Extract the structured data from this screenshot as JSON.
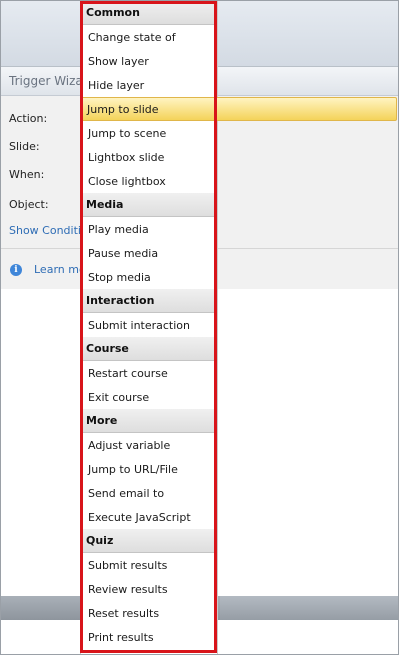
{
  "wizard": {
    "title": "Trigger Wiza",
    "labels": {
      "action": "Action:",
      "slide": "Slide:",
      "when": "When:",
      "object": "Object:"
    },
    "show_conditions": "Show Condition",
    "learn_more": "Learn mo"
  },
  "menu": {
    "sections": [
      {
        "title": "Common",
        "items": [
          "Change state of",
          "Show layer",
          "Hide layer",
          "Jump to slide",
          "Jump to scene",
          "Lightbox slide",
          "Close lightbox"
        ]
      },
      {
        "title": "Media",
        "items": [
          "Play media",
          "Pause media",
          "Stop media"
        ]
      },
      {
        "title": "Interaction",
        "items": [
          "Submit interaction"
        ]
      },
      {
        "title": "Course",
        "items": [
          "Restart course",
          "Exit course"
        ]
      },
      {
        "title": "More",
        "items": [
          "Adjust variable",
          "Jump to URL/File",
          "Send email to",
          "Execute JavaScript"
        ]
      },
      {
        "title": "Quiz",
        "items": [
          "Submit results",
          "Review results",
          "Reset results",
          "Print results"
        ]
      }
    ],
    "selected": "Jump to slide"
  },
  "colors": {
    "highlight_border": "#d8141a",
    "selection": "#f4d35a",
    "link": "#2f6db5"
  }
}
